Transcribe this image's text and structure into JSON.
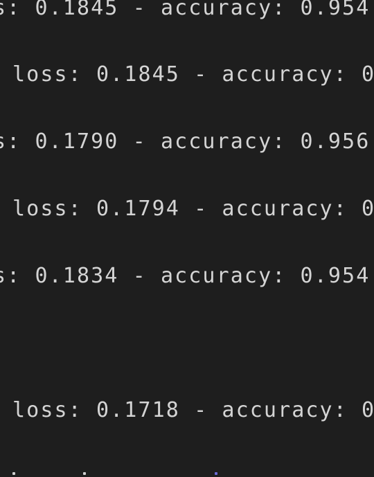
{
  "terminal": {
    "lines": [
      "s: 0.1845 - accuracy: 0.954",
      "loss: 0.1845 - accuracy: 0",
      "s: 0.1790 - accuracy: 0.956",
      "loss: 0.1794 - accuracy: 0",
      "s: 0.1834 - accuracy: 0.954",
      "loss: 0.1718 - accuracy: 0"
    ]
  },
  "colors": {
    "background": "#1e1e1e",
    "text": "#d4d4d4"
  }
}
